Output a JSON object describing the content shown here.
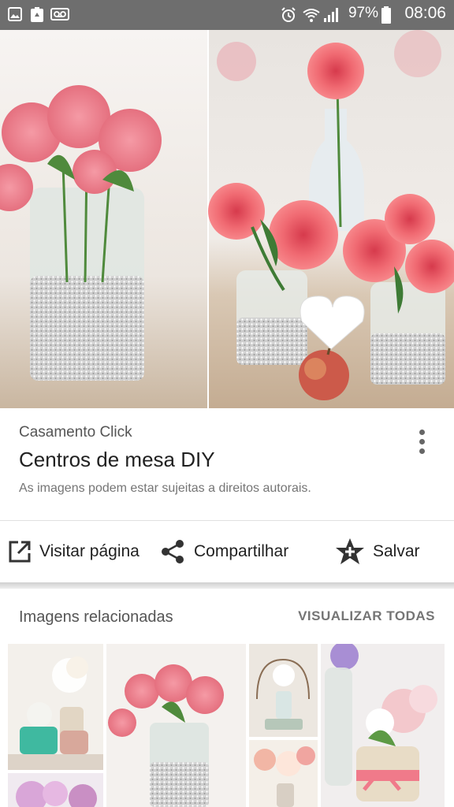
{
  "status_bar": {
    "battery_percent": "97%",
    "time": "08:06"
  },
  "result": {
    "source": "Casamento Click",
    "title": "Centros de mesa DIY",
    "copyright_note": "As imagens podem estar sujeitas a direitos autorais."
  },
  "actions": {
    "visit_label": "Visitar página",
    "share_label": "Compartilhar",
    "save_label": "Salvar"
  },
  "related": {
    "heading": "Imagens relacionadas",
    "view_all_label": "VISUALIZAR TODAS"
  }
}
